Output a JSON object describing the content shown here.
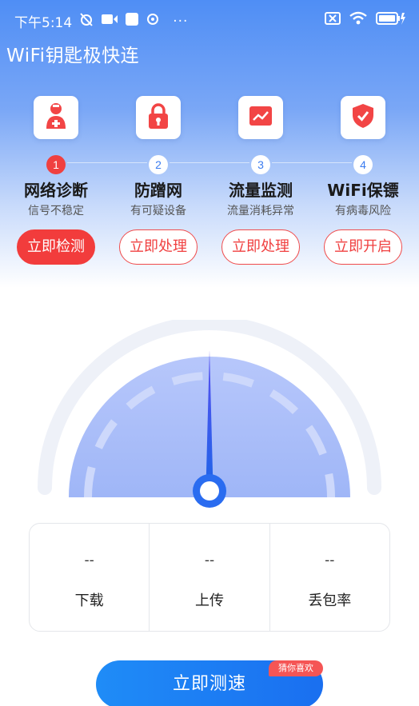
{
  "status_bar": {
    "time": "下午5:14",
    "more": "···"
  },
  "app": {
    "title": "WiFi钥匙极快连"
  },
  "features": [
    {
      "step": "1",
      "title": "网络诊断",
      "subtitle": "信号不稳定",
      "button": "立即检测",
      "icon": "doctor-icon",
      "active": true
    },
    {
      "step": "2",
      "title": "防蹭网",
      "subtitle": "有可疑设备",
      "button": "立即处理",
      "icon": "lock-icon",
      "active": false
    },
    {
      "step": "3",
      "title": "流量监测",
      "subtitle": "流量消耗异常",
      "button": "立即处理",
      "icon": "trend-chart-icon",
      "active": false
    },
    {
      "step": "4",
      "title": "WiFi保镖",
      "subtitle": "有病毒风险",
      "button": "立即开启",
      "icon": "shield-check-icon",
      "active": false
    }
  ],
  "stats": [
    {
      "value": "--",
      "label": "下载"
    },
    {
      "value": "--",
      "label": "上传"
    },
    {
      "value": "--",
      "label": "丢包率"
    }
  ],
  "speed_test": {
    "button": "立即测速",
    "badge": "猜你喜欢"
  },
  "colors": {
    "accent_blue": "#1a6ff0",
    "alert_red": "#f23c3c"
  }
}
